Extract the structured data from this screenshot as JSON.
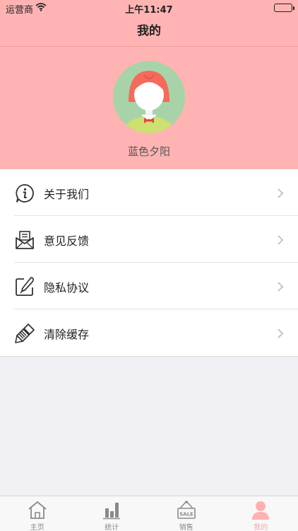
{
  "status_bar": {
    "carrier": "运营商",
    "time": "上午11:47"
  },
  "nav": {
    "title": "我的"
  },
  "profile": {
    "username": "蓝色夕阳"
  },
  "menu": {
    "items": [
      {
        "label": "关于我们",
        "icon": "info-icon"
      },
      {
        "label": "意见反馈",
        "icon": "feedback-mail-icon"
      },
      {
        "label": "隐私协议",
        "icon": "edit-pen-icon"
      },
      {
        "label": "清除缓存",
        "icon": "broom-icon"
      }
    ]
  },
  "tab_bar": {
    "items": [
      {
        "label": "主页",
        "icon": "home-icon",
        "active": false
      },
      {
        "label": "统计",
        "icon": "bar-chart-icon",
        "active": false
      },
      {
        "label": "销售",
        "icon": "sale-sign-icon",
        "active": false
      },
      {
        "label": "我的",
        "icon": "user-icon",
        "active": true
      }
    ]
  },
  "colors": {
    "header_bg": "#ffb3b3",
    "active_tab": "#ffa3a3",
    "page_bg": "#efeff4"
  }
}
